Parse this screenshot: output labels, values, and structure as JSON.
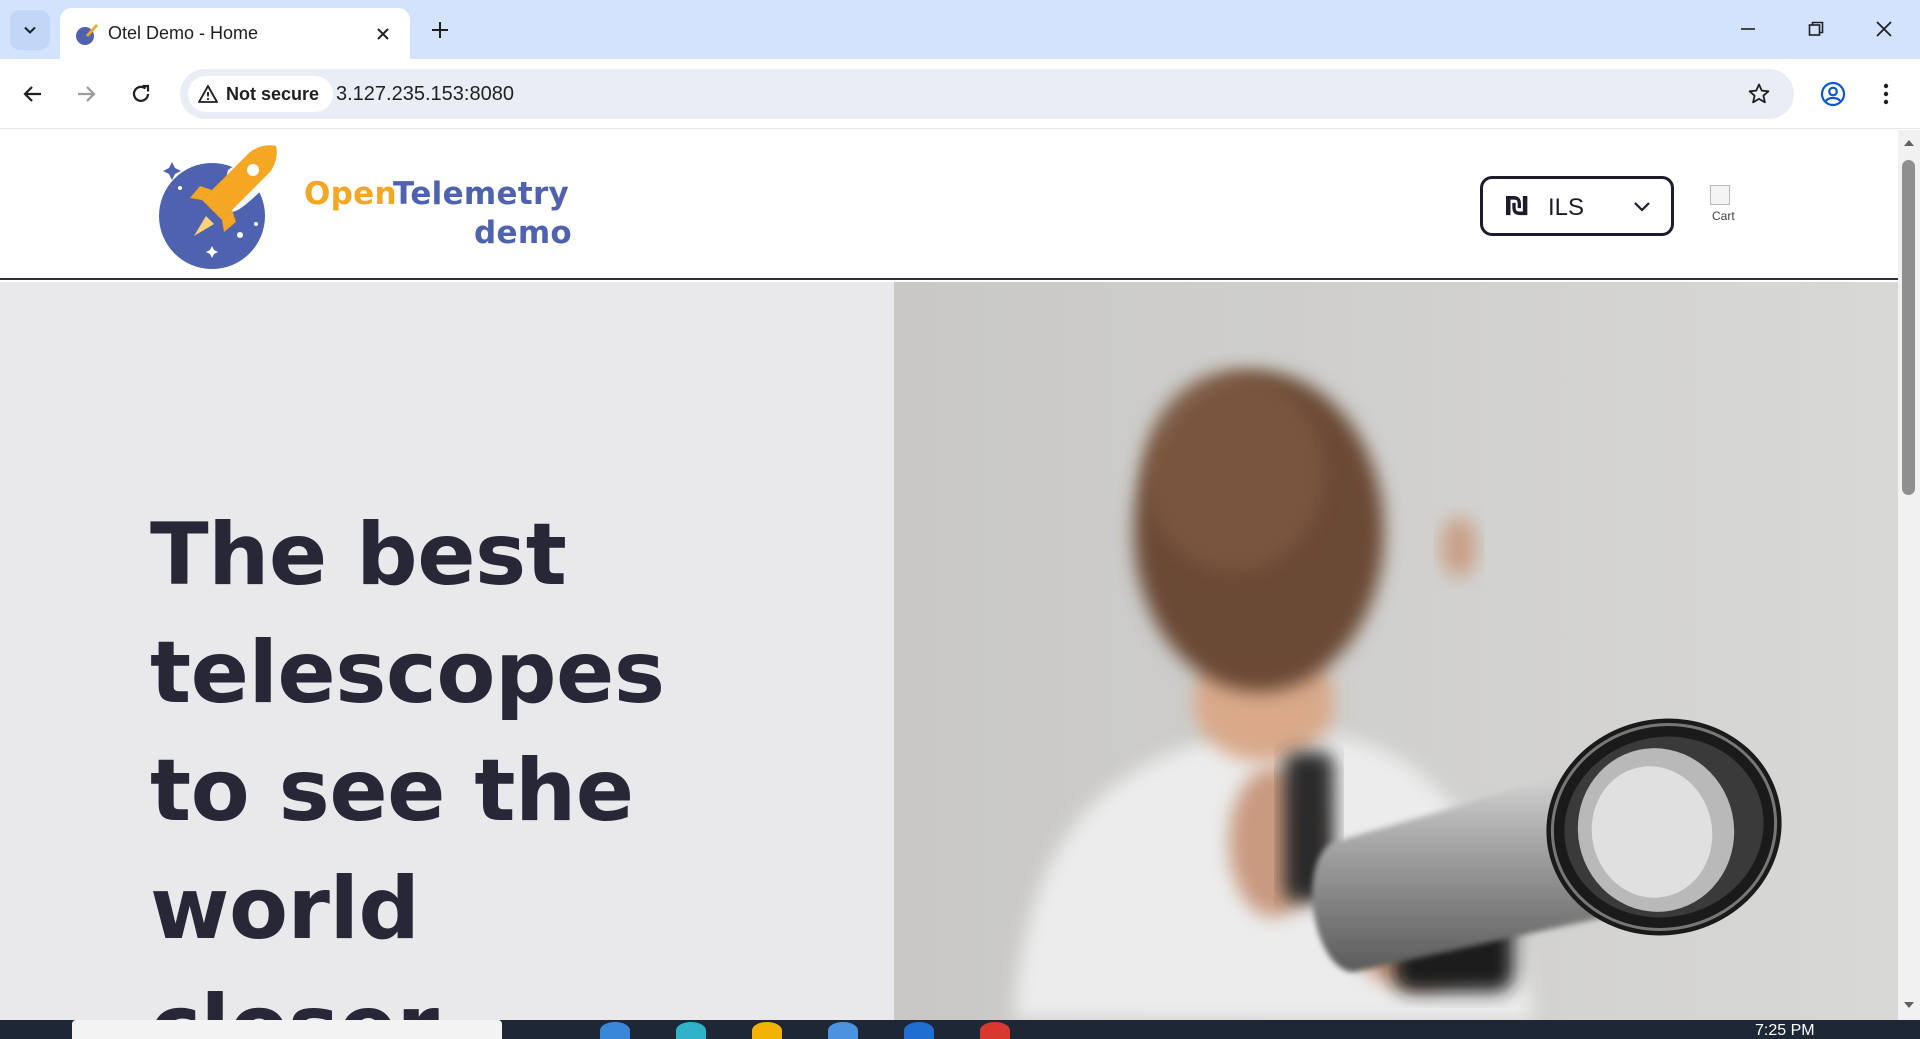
{
  "browser": {
    "tab_title": "Otel Demo - Home",
    "security_label": "Not secure",
    "url": "3.127.235.153:8080"
  },
  "site": {
    "logo_open": "Open",
    "logo_telemetry": "Telemetry",
    "logo_demo": "demo",
    "currency": {
      "symbol": "₪",
      "code": "ILS"
    },
    "cart_alt": "Cart"
  },
  "hero": {
    "title_lines": [
      "The best",
      "telescopes",
      "to see the",
      "world",
      "closer"
    ]
  },
  "taskbar": {
    "clock": "7:25 PM"
  },
  "colors": {
    "tabbar": "#d3e3fd",
    "hero_text": "#272738",
    "logo_orange": "#f5a623",
    "logo_blue": "#4f62b0"
  }
}
